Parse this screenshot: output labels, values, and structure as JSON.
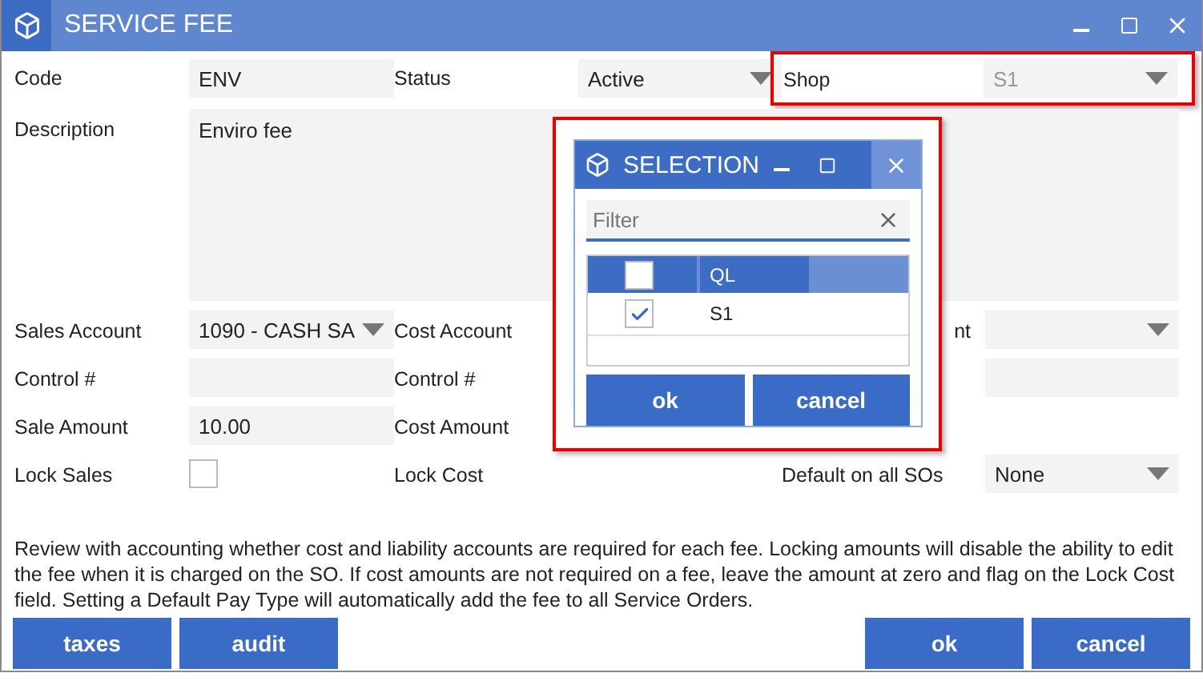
{
  "window": {
    "title": "SERVICE FEE"
  },
  "form": {
    "rows": [
      [
        {
          "kind": "text",
          "label": "Code",
          "value": "ENV"
        },
        {
          "kind": "dropdown",
          "label": "Status",
          "value": "Active"
        },
        {
          "kind": "dropdown",
          "label": "Shop",
          "value": "S1",
          "disabled": true,
          "highlighted": true
        }
      ],
      [
        {
          "kind": "textarea",
          "label": "Description",
          "value": "Enviro fee"
        }
      ],
      [
        {
          "kind": "dropdown",
          "label": "Sales Account",
          "value": "1090 - CASH SA"
        },
        {
          "kind": "label",
          "label": "Cost Account"
        },
        {
          "kind": "dropdown",
          "label": "nt",
          "partial": true
        }
      ],
      [
        {
          "kind": "text",
          "label": "Control #"
        },
        {
          "kind": "label",
          "label": "Control #"
        },
        {
          "kind": "text"
        }
      ],
      [
        {
          "kind": "text",
          "label": "Sale Amount",
          "value": "10.00"
        },
        {
          "kind": "label",
          "label": "Cost Amount"
        },
        {
          "kind": "blank"
        }
      ],
      [
        {
          "kind": "checkbox",
          "label": "Lock Sales",
          "checked": false
        },
        {
          "kind": "label",
          "label": "Lock Cost"
        },
        {
          "kind": "dropdown",
          "label": "Default on all SOs",
          "value": "None"
        }
      ]
    ]
  },
  "selection_dialog": {
    "title": "SELECTION",
    "highlighted": true,
    "filter": {
      "placeholder": "Filter"
    },
    "header_checked": false,
    "columns": [
      "QL"
    ],
    "rows": [
      {
        "value": "S1",
        "checked": true
      }
    ],
    "buttons": [
      "ok",
      "cancel"
    ]
  },
  "note": "Review with accounting whether cost and liability accounts are required for each fee. Locking amounts will disable the ability to edit the fee when it is charged on the SO. If cost amounts are not required on a fee, leave the amount at zero and flag on the Lock Cost field. Setting a Default Pay Type will automatically add the fee to all Service Orders.",
  "left_buttons": [
    "taxes",
    "audit"
  ],
  "right_buttons": [
    "ok",
    "cancel"
  ]
}
